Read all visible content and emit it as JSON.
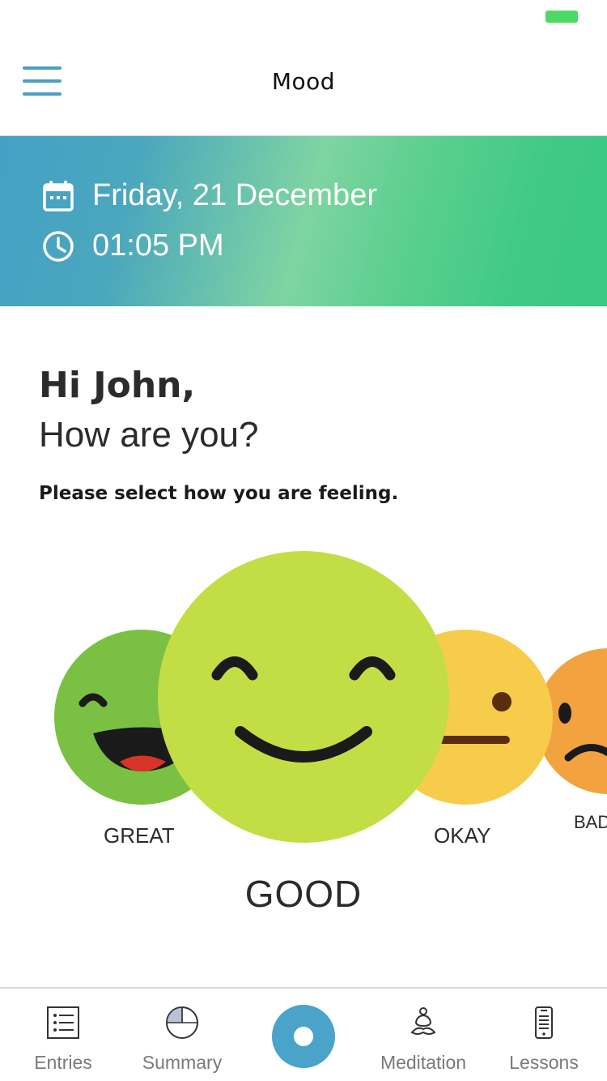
{
  "nav": {
    "title": "Mood"
  },
  "banner": {
    "date": "Friday, 21 December",
    "time": "01:05 PM"
  },
  "greeting": {
    "hello": "Hi John,",
    "question": "How are you?",
    "prompt": "Please select how you are feeling."
  },
  "moods": {
    "options": [
      "GREAT",
      "GOOD",
      "OKAY",
      "BAD"
    ],
    "selected": "GOOD",
    "colors": {
      "great": "#7ac143",
      "good": "#c3de45",
      "okay": "#f8cc4b",
      "bad": "#f2a23e"
    }
  },
  "tabs": {
    "entries": "Entries",
    "summary": "Summary",
    "meditation": "Meditation",
    "lessons": "Lessons"
  },
  "colors": {
    "accent": "#4aa3c9",
    "banner_start": "#45a0c6",
    "banner_end": "#3ac882",
    "status_battery": "#4cd964"
  }
}
